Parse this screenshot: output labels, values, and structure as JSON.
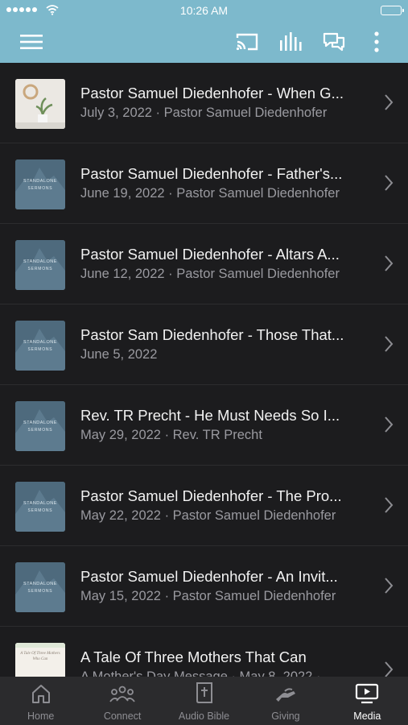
{
  "status_bar": {
    "time": "10:26 AM"
  },
  "app_bar": {
    "icons": [
      "menu-icon",
      "cast-icon",
      "audio-bars-icon",
      "chat-icon",
      "more-vertical-icon"
    ]
  },
  "media_list": [
    {
      "title": "Pastor Samuel Diedenhofer - When G...",
      "subtitle": "July 3, 2022 · Pastor Samuel Diedenhofer",
      "thumbnail": "plant-photo"
    },
    {
      "title": "Pastor Samuel Diedenhofer - Father's...",
      "subtitle": "June 19, 2022 · Pastor Samuel Diedenhofer",
      "thumbnail": "standalone-sermons"
    },
    {
      "title": "Pastor Samuel Diedenhofer - Altars A...",
      "subtitle": "June 12, 2022 · Pastor Samuel Diedenhofer",
      "thumbnail": "standalone-sermons"
    },
    {
      "title": "Pastor Sam Diedenhofer - Those That...",
      "subtitle": "June 5, 2022",
      "thumbnail": "standalone-sermons"
    },
    {
      "title": "Rev. TR Precht - He Must Needs So I...",
      "subtitle": "May 29, 2022 · Rev. TR Precht",
      "thumbnail": "standalone-sermons"
    },
    {
      "title": "Pastor Samuel Diedenhofer - The Pro...",
      "subtitle": "May 22, 2022 · Pastor Samuel Diedenhofer",
      "thumbnail": "standalone-sermons"
    },
    {
      "title": "Pastor Samuel Diedenhofer - An Invit...",
      "subtitle": "May 15, 2022 · Pastor Samuel Diedenhofer",
      "thumbnail": "standalone-sermons"
    },
    {
      "title": "A Tale Of Three Mothers That Can",
      "subtitle": "A Mother's Day Message · May 8, 2022 ·",
      "thumbnail": "mothers-day"
    }
  ],
  "thumbnail_text": {
    "standalone_line1": "STANDALONE",
    "standalone_line2": "SERMONS",
    "mothers_line1": "A Tale Of Three Mothers",
    "mothers_line2": "Who Can"
  },
  "tab_bar": {
    "tabs": [
      {
        "label": "Home",
        "icon": "home-icon"
      },
      {
        "label": "Connect",
        "icon": "people-icon"
      },
      {
        "label": "Audio Bible",
        "icon": "bible-icon"
      },
      {
        "label": "Giving",
        "icon": "giving-hand-icon"
      },
      {
        "label": "Media",
        "icon": "media-play-icon"
      }
    ],
    "active": "Media"
  },
  "colors": {
    "header": "#7db9cc",
    "list_background": "#1c1c1e",
    "tab_bar": "#2b2b2d",
    "active_tab": "#ffffff",
    "inactive_tab": "#8e8e93"
  }
}
